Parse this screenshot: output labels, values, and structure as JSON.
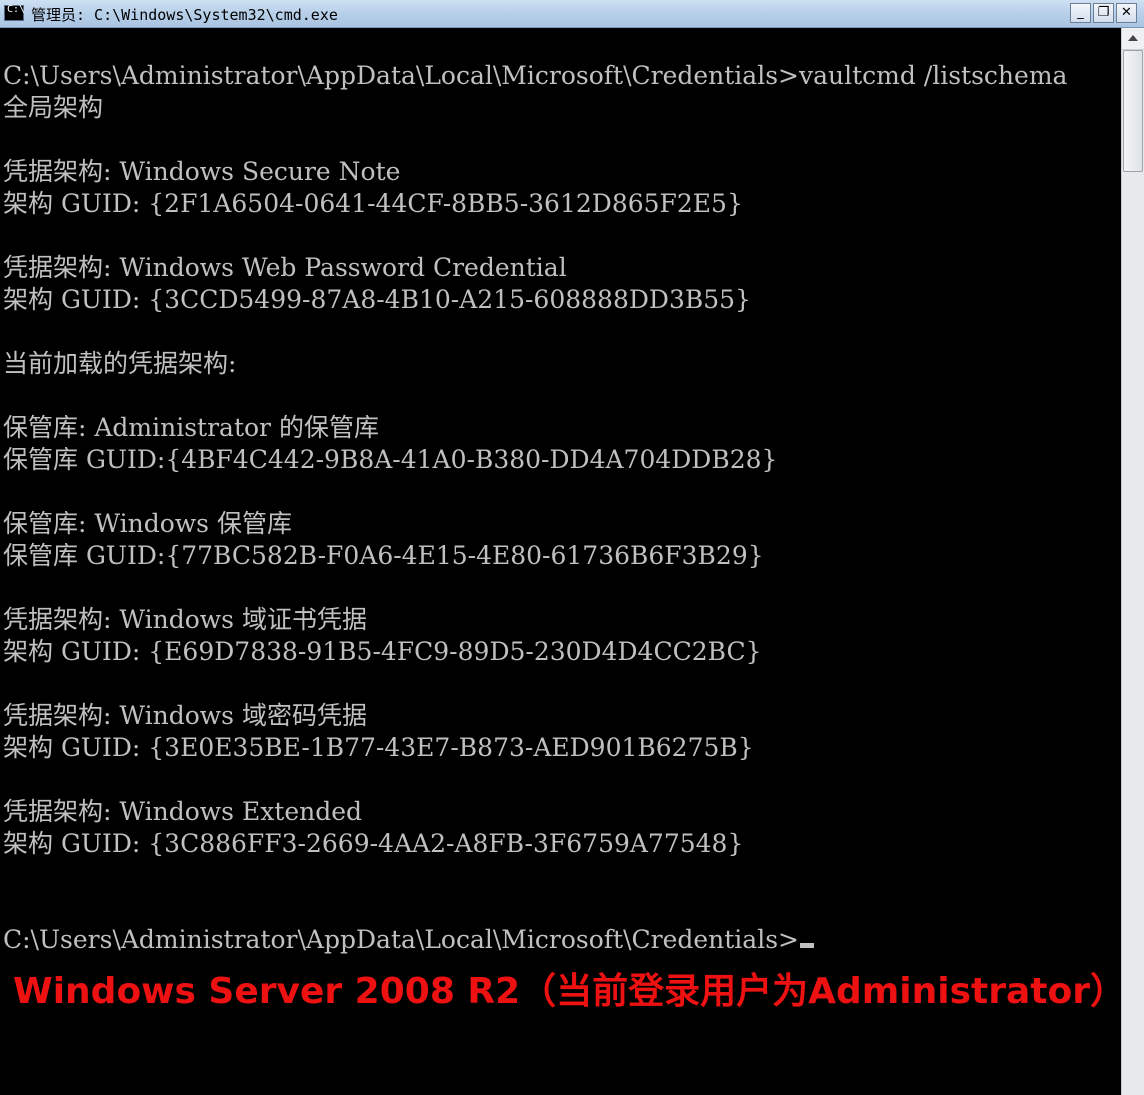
{
  "window": {
    "title": "管理员: C:\\Windows\\System32\\cmd.exe",
    "system_icon": "cmd-console-icon",
    "system_icon_glyph": "C:\\",
    "controls": {
      "minimize": "_",
      "maximize": "❐",
      "close": "✕"
    }
  },
  "console": {
    "lines": [
      "C:\\Users\\Administrator\\AppData\\Local\\Microsoft\\Credentials>vaultcmd /listschema",
      "全局架构",
      "",
      "凭据架构: Windows Secure Note",
      "架构 GUID: {2F1A6504-0641-44CF-8BB5-3612D865F2E5}",
      "",
      "凭据架构: Windows Web Password Credential",
      "架构 GUID: {3CCD5499-87A8-4B10-A215-608888DD3B55}",
      "",
      "当前加载的凭据架构:",
      "",
      "保管库: Administrator 的保管库",
      "保管库 GUID:{4BF4C442-9B8A-41A0-B380-DD4A704DDB28}",
      "",
      "保管库: Windows 保管库",
      "保管库 GUID:{77BC582B-F0A6-4E15-4E80-61736B6F3B29}",
      "",
      "凭据架构: Windows 域证书凭据",
      "架构 GUID: {E69D7838-91B5-4FC9-89D5-230D4D4CC2BC}",
      "",
      "凭据架构: Windows 域密码凭据",
      "架构 GUID: {3E0E35BE-1B77-43E7-B873-AED901B6275B}",
      "",
      "凭据架构: Windows Extended",
      "架构 GUID: {3C886FF3-2669-4AA2-A8FB-3F6759A77548}",
      "",
      "",
      "C:\\Users\\Administrator\\AppData\\Local\\Microsoft\\Credentials>"
    ],
    "text_color": "#c0c0c0",
    "background_color": "#000000"
  },
  "overlay": {
    "caption": "Windows Server 2008 R2（当前登录用户为Administrator）",
    "caption_color": "#ee1111"
  },
  "scrollbar": {
    "up_arrow": "scroll-up-arrow-icon"
  }
}
